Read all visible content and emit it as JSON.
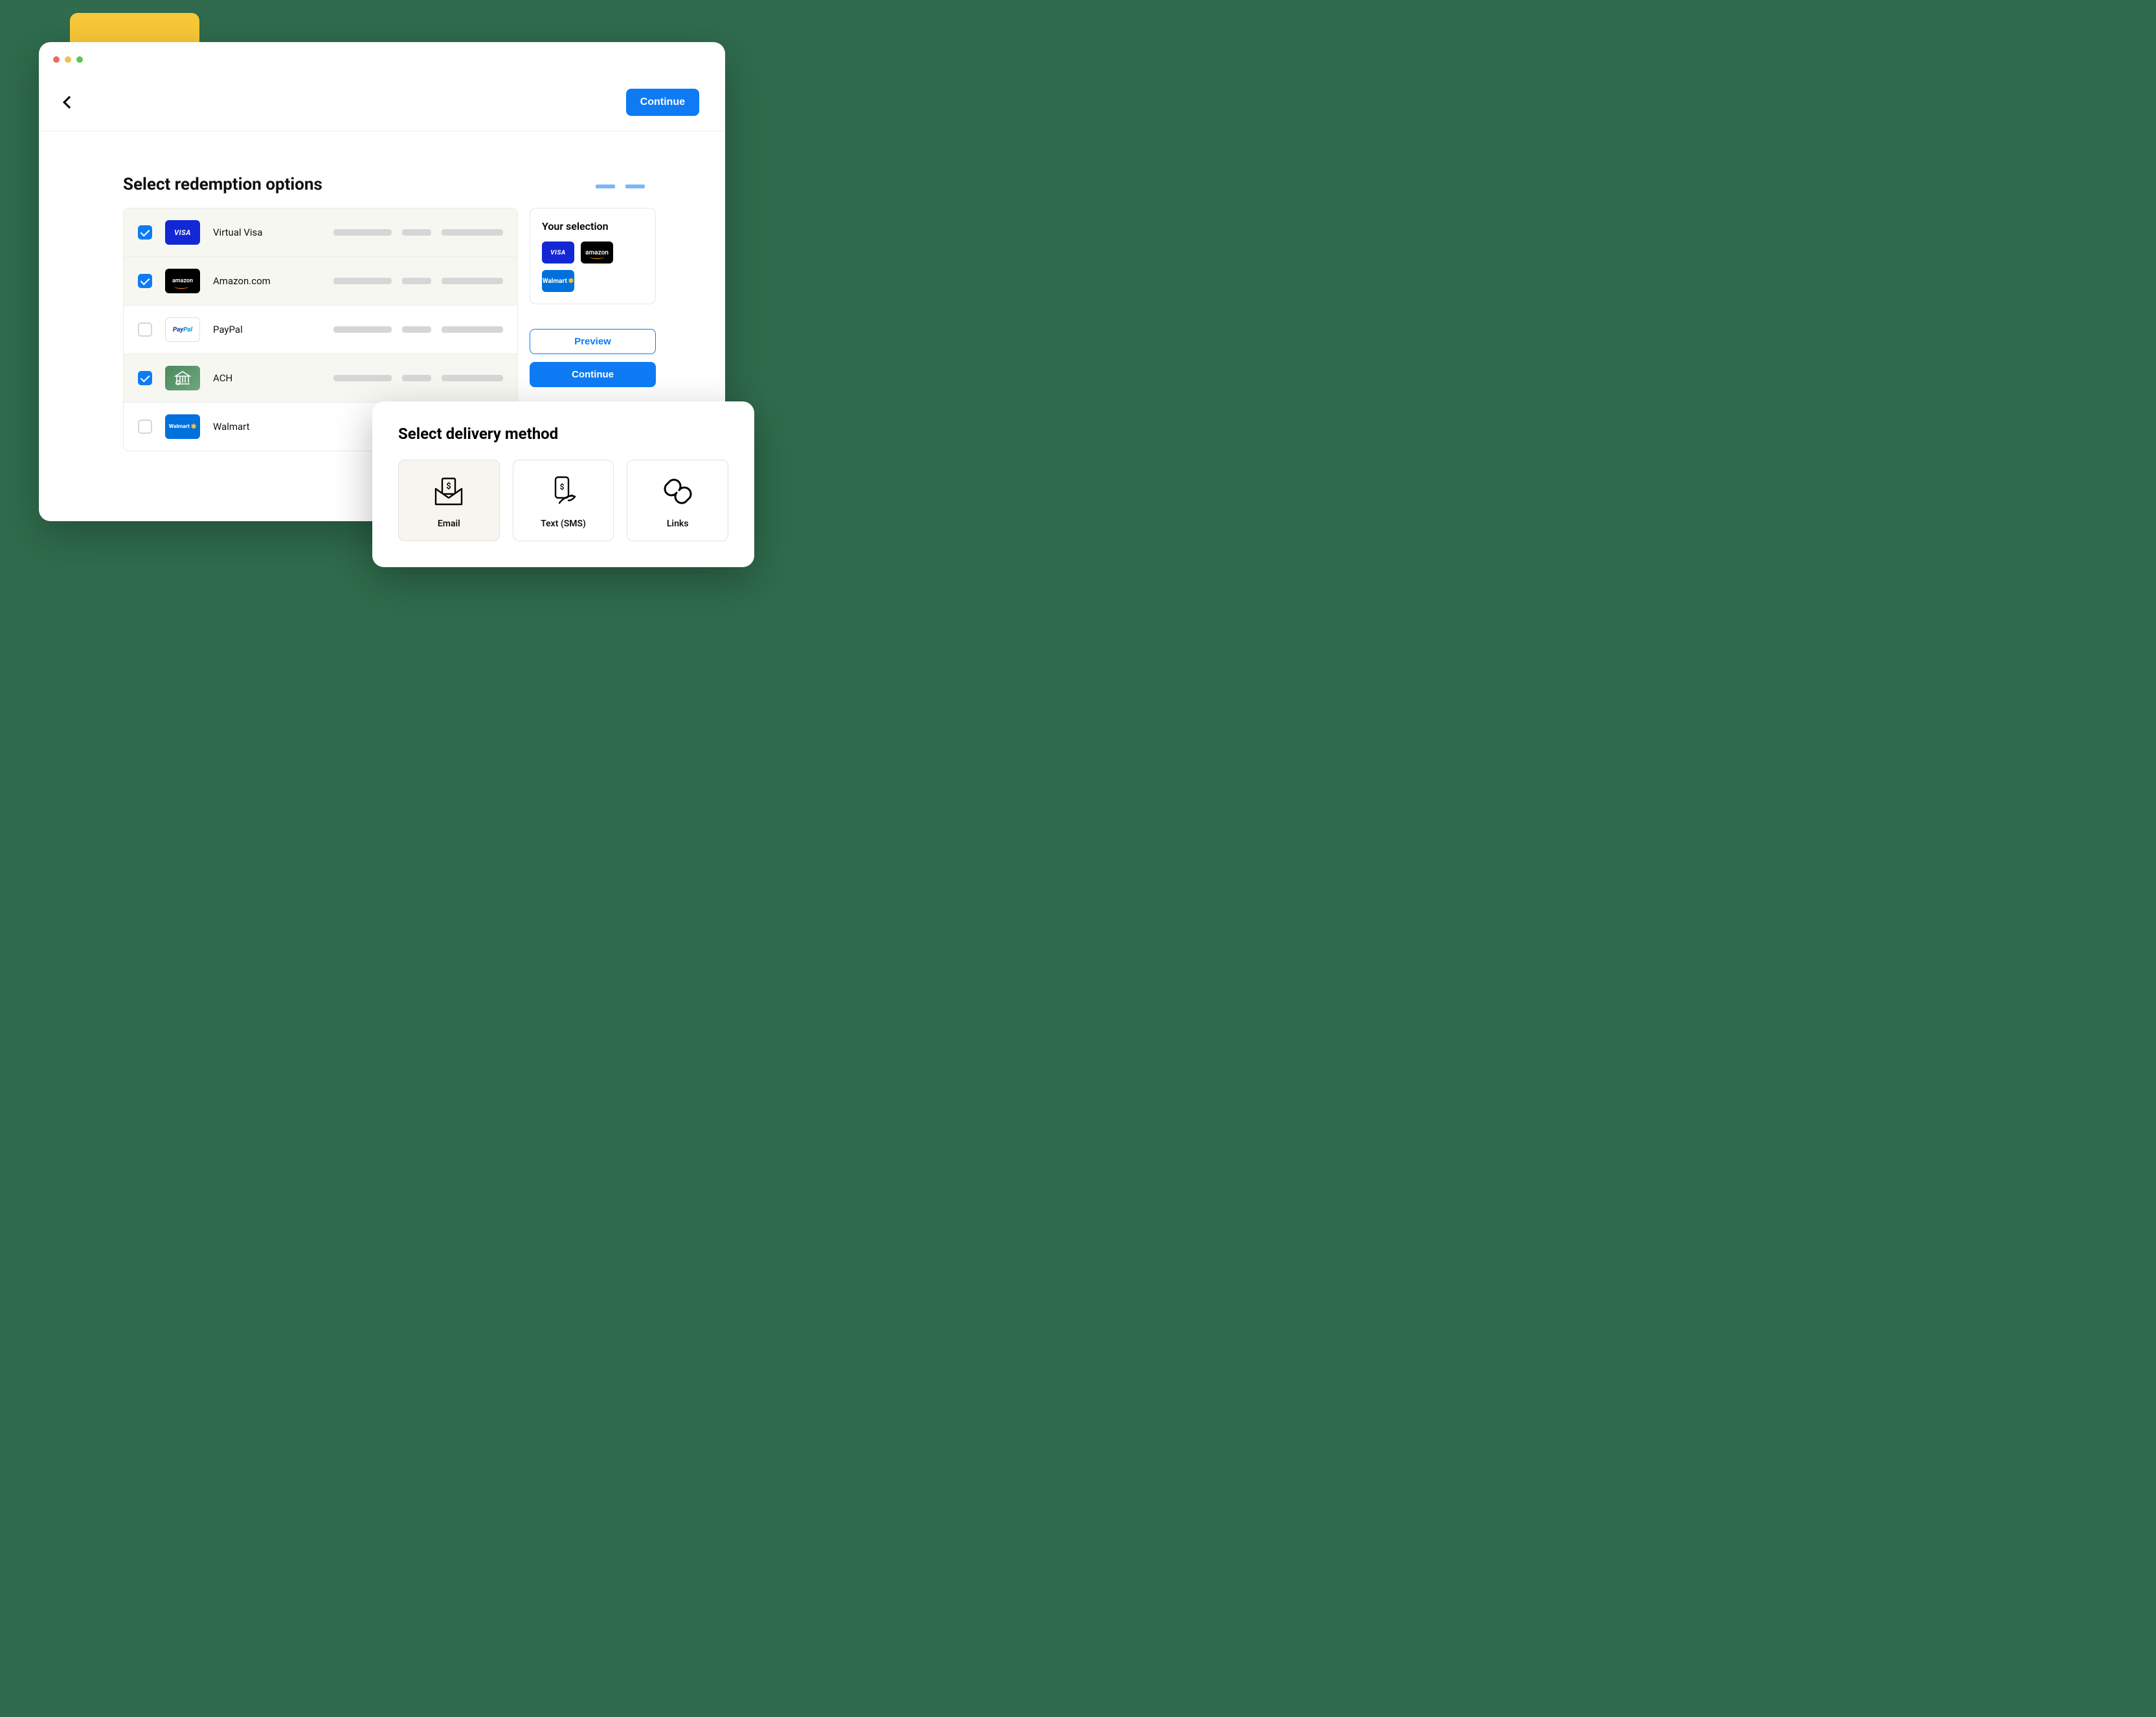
{
  "header": {
    "continue_label": "Continue"
  },
  "page_title": "Select redemption options",
  "options": [
    {
      "label": "Virtual Visa",
      "brand": "VISA",
      "checked": true
    },
    {
      "label": "Amazon.com",
      "brand": "amazon",
      "checked": true
    },
    {
      "label": "PayPal",
      "brand": "PayPal",
      "checked": false
    },
    {
      "label": "ACH",
      "brand": "ACH",
      "checked": true
    },
    {
      "label": "Walmart",
      "brand": "Walmart",
      "checked": false
    }
  ],
  "selection_card": {
    "title": "Your selection",
    "badges": [
      "VISA",
      "amazon",
      "Walmart"
    ]
  },
  "actions": {
    "preview_label": "Preview",
    "continue_label": "Continue"
  },
  "delivery": {
    "title": "Select delivery method",
    "methods": [
      {
        "label": "Email",
        "selected": true
      },
      {
        "label": "Text (SMS)",
        "selected": false
      },
      {
        "label": "Links",
        "selected": false
      }
    ]
  }
}
